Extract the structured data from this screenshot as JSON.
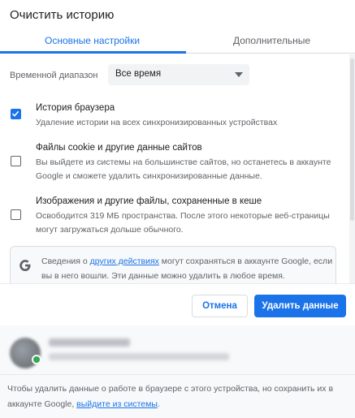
{
  "dialog": {
    "title": "Очистить историю"
  },
  "tabs": [
    {
      "label": "Основные настройки",
      "active": true
    },
    {
      "label": "Дополнительные",
      "active": false
    }
  ],
  "time_range": {
    "label": "Временной диапазон",
    "selected": "Все время"
  },
  "options": [
    {
      "title": "История браузера",
      "description": "Удаление истории на всех синхронизированных устройствах",
      "checked": true
    },
    {
      "title": "Файлы cookie и другие данные сайтов",
      "description": "Вы выйдете из системы на большинстве сайтов, но останетесь в аккаунте Google и сможете удалить синхронизированные данные.",
      "checked": false
    },
    {
      "title": "Изображения и другие файлы, сохраненные в кеше",
      "description": "Освободится 319 МБ пространства. После этого некоторые веб-страницы могут загружаться дольше обычного.",
      "checked": false
    }
  ],
  "info": {
    "prefix": "Сведения о ",
    "link": "других действиях",
    "suffix": " могут сохраняться в аккаунте Google, если вы в него вошли. Эти данные можно удалить в любое время."
  },
  "buttons": {
    "cancel": "Отмена",
    "delete": "Удалить данные"
  },
  "signout": {
    "text": "Чтобы удалить данные о работе в браузере с этого устройства, но сохранить их в аккаунте Google, ",
    "link": "выйдите из системы",
    "suffix": "."
  },
  "colors": {
    "accent": "#1a73e8",
    "text": "#202124",
    "muted": "#5f6368"
  }
}
